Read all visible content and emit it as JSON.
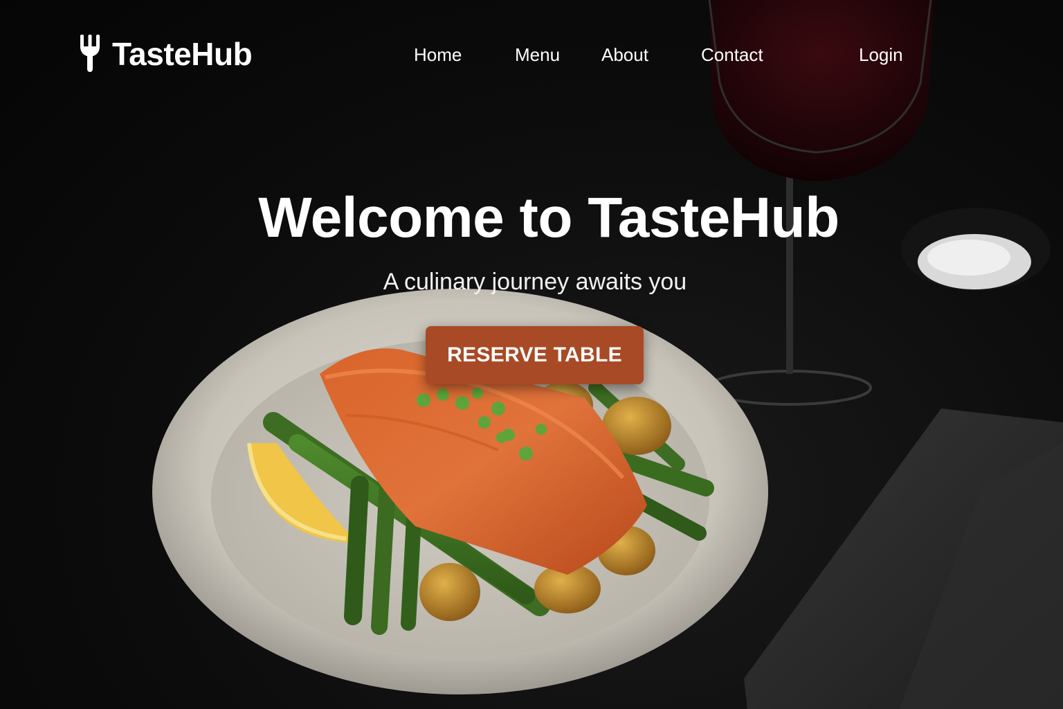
{
  "brand": {
    "name": "TasteHub",
    "icon": "fork-icon"
  },
  "nav": {
    "items": [
      {
        "label": "Home"
      },
      {
        "label": "Menu"
      },
      {
        "label": "About"
      },
      {
        "label": "Contact"
      }
    ],
    "login_label": "Login"
  },
  "hero": {
    "title": "Welcome to TasteHub",
    "subtitle": "A culinary journey awaits you",
    "cta_label": "RESERVE TABLE",
    "image_icon": "plated-salmon-dinner-photo"
  },
  "colors": {
    "background": "#0b0b0b",
    "accent": "#a94a26",
    "text": "#ffffff"
  }
}
